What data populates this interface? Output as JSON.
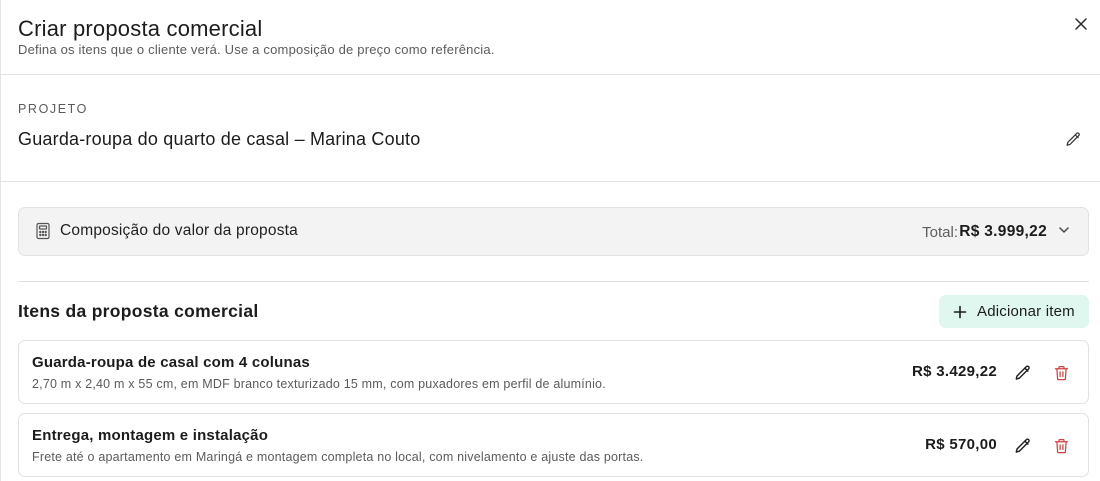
{
  "header": {
    "title": "Criar proposta comercial",
    "subtitle": "Defina os itens que o cliente verá. Use a composição de preço como referência."
  },
  "project": {
    "label": "PROJETO",
    "name": "Guarda-roupa do quarto de casal – Marina Couto"
  },
  "composition": {
    "label": "Composição do valor da proposta",
    "total_label": "Total:",
    "total_value": "R$ 3.999,22"
  },
  "items_section": {
    "title": "Itens da proposta comercial",
    "add_label": "Adicionar item"
  },
  "items": [
    {
      "name": "Guarda-roupa de casal com 4 colunas",
      "description": "2,70 m x 2,40 m x 55 cm, em MDF branco texturizado 15 mm, com puxadores em perfil de alumínio.",
      "price": "R$ 3.429,22"
    },
    {
      "name": "Entrega, montagem e instalação",
      "description": "Frete até o apartamento em Maringá e montagem completa no local, com nivelamento e ajuste das portas.",
      "price": "R$ 570,00"
    }
  ],
  "icons": {
    "close": "close-icon",
    "edit": "pencil-icon",
    "calculator": "calculator-icon",
    "chevron": "chevron-down-icon",
    "add": "plus-icon",
    "delete": "trash-icon"
  },
  "colors": {
    "accent_bg": "#dff7ee",
    "delete": "#d14343",
    "panel_bg": "#f3f3f3"
  }
}
